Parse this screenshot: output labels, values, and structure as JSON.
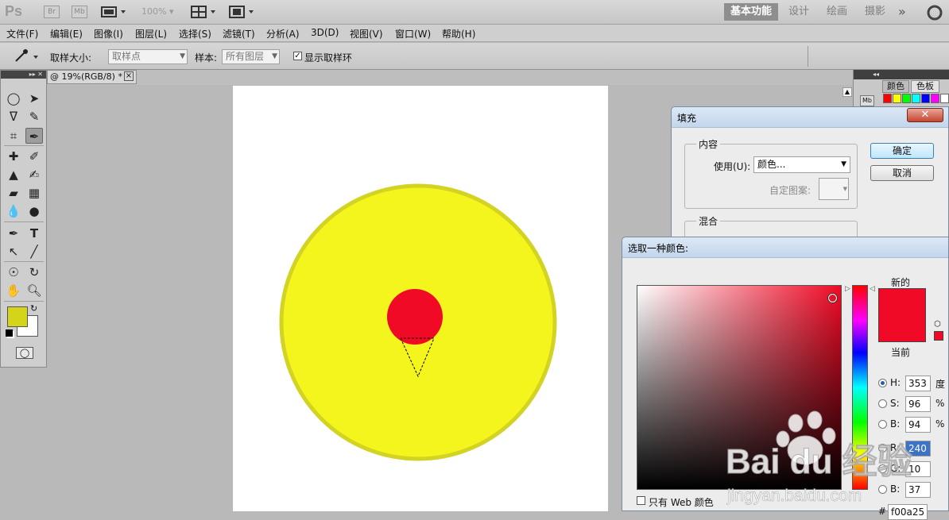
{
  "appbar": {
    "logo": "Ps",
    "br_label": "Br",
    "mb_label": "Mb",
    "zoom": "100%",
    "workspaces": [
      "基本功能",
      "设计",
      "绘画",
      "摄影"
    ],
    "more": "»"
  },
  "menu": [
    "文件(F)",
    "编辑(E)",
    "图像(I)",
    "图层(L)",
    "选择(S)",
    "滤镜(T)",
    "分析(A)",
    "3D(D)",
    "视图(V)",
    "窗口(W)",
    "帮助(H)"
  ],
  "options": {
    "sample_size_label": "取样大小:",
    "sample_size_value": "取样点",
    "sample_label": "样本:",
    "sample_value": "所有图层",
    "show_ring_label": "显示取样环"
  },
  "document": {
    "tab_title": "@ 19%(RGB/8) *",
    "close": "×"
  },
  "right_panel": {
    "tabs": [
      "颜色",
      "色板"
    ],
    "mb_label": "Mb",
    "swatch_colors": [
      "#ff0000",
      "#ffff00",
      "#00ff00",
      "#00ffff",
      "#0000ff",
      "#ff00ff",
      "#ffffff"
    ]
  },
  "fill_dialog": {
    "title": "填充",
    "content_group": "内容",
    "use_label": "使用(U):",
    "use_value": "颜色...",
    "custom_pattern_label": "自定图案:",
    "blend_group": "混合",
    "ok": "确定",
    "cancel": "取消",
    "close": "✕"
  },
  "color_picker": {
    "title": "选取一种颜色:",
    "new_label": "新的",
    "current_label": "当前",
    "new_color": "#f00a25",
    "hsb": [
      {
        "label": "H:",
        "value": "353",
        "unit": "度",
        "selected": true
      },
      {
        "label": "S:",
        "value": "96",
        "unit": "%",
        "selected": false
      },
      {
        "label": "B:",
        "value": "94",
        "unit": "%",
        "selected": false
      }
    ],
    "rgb": [
      {
        "label": "R:",
        "value": "240"
      },
      {
        "label": "G:",
        "value": "10"
      },
      {
        "label": "B:",
        "value": "37"
      }
    ],
    "hex_partial": "f00a25",
    "web_only_label": "只有 Web 颜色"
  },
  "colors": {
    "foreground": "#d4d41a",
    "background": "#ffffff",
    "outer_circle": "#f5f51e",
    "outer_circle_border": "#d3d323",
    "inner_circle": "#f00a25"
  },
  "watermark": {
    "brand": "Bai du 经验",
    "url": "jingyan.baidu.com"
  }
}
